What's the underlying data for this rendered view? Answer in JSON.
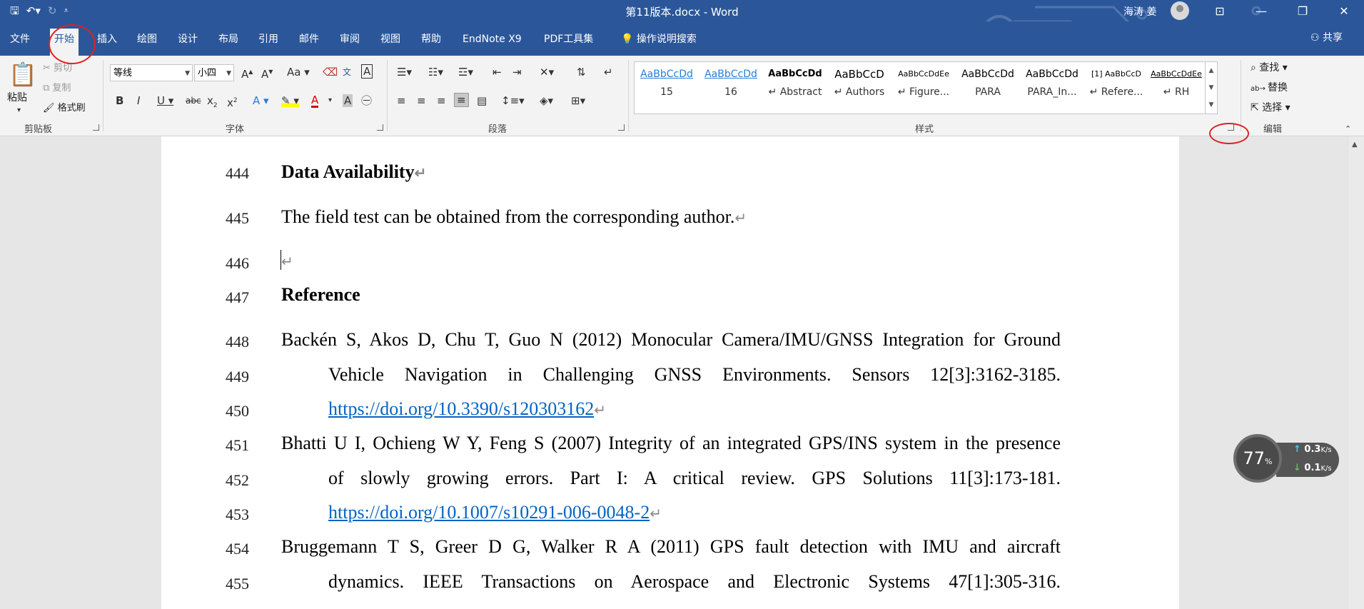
{
  "window": {
    "title": "第11版本.docx  -  Word",
    "user": "海涛 姜",
    "qat_icons": [
      "save-icon",
      "undo-icon",
      "redo-icon",
      "customize-qat-icon"
    ],
    "controls": [
      "ribbon-display-icon",
      "minimize-icon",
      "restore-icon",
      "close-icon"
    ]
  },
  "tabs": [
    "文件",
    "开始",
    "插入",
    "绘图",
    "设计",
    "布局",
    "引用",
    "邮件",
    "审阅",
    "视图",
    "帮助",
    "EndNote X9",
    "PDF工具集",
    "操作说明搜索"
  ],
  "share_label": "共享",
  "ribbon": {
    "clipboard": {
      "paste": "粘贴",
      "cut": "剪切",
      "copy": "复制",
      "format_painter": "格式刷",
      "label": "剪贴板"
    },
    "font": {
      "name": "等线",
      "size": "小四",
      "label": "字体",
      "change_case": "Aa"
    },
    "paragraph": {
      "label": "段落"
    },
    "styles": {
      "label": "样式",
      "items": [
        {
          "preview": "AaBbCcDd",
          "name": "15"
        },
        {
          "preview": "AaBbCcDd",
          "name": "16"
        },
        {
          "preview": "AaBbCcDd",
          "name": "↵ Abstract"
        },
        {
          "preview": "AaBbCcD",
          "name": "↵ Authors"
        },
        {
          "preview": "AaBbCcDdEe",
          "name": "↵ Figure..."
        },
        {
          "preview": "AaBbCcDd",
          "name": "PARA"
        },
        {
          "preview": "AaBbCcDd",
          "name": "PARA_In..."
        },
        {
          "preview": "[1] AaBbCcD",
          "name": "↵ Refere..."
        },
        {
          "preview": "AaBbCcDdEe",
          "name": "↵ RH"
        }
      ]
    },
    "editing": {
      "find": "查找",
      "replace": "替换",
      "select": "选择",
      "label": "编辑"
    }
  },
  "document": {
    "lines": [
      {
        "num": "444",
        "text": "Data Availability",
        "bold": true
      },
      {
        "num": "445",
        "text": "The field test can be obtained from the corresponding author."
      },
      {
        "num": "446",
        "text": ""
      },
      {
        "num": "447",
        "text": "Reference",
        "bold": true
      },
      {
        "num": "448",
        "text": "Backén S, Akos D, Chu T, Guo N (2012) Monocular Camera/IMU/GNSS Integration for Ground"
      },
      {
        "num": "449",
        "text": "Vehicle Navigation in Challenging GNSS Environments. Sensors 12[3]:3162-3185."
      },
      {
        "num": "450",
        "text": "https://doi.org/10.3390/s120303162"
      },
      {
        "num": "451",
        "text": "Bhatti U I, Ochieng W Y, Feng S (2007) Integrity of an integrated GPS/INS system in the presence"
      },
      {
        "num": "452",
        "text": "of slowly growing errors. Part I: A critical review. GPS Solutions 11[3]:173-181."
      },
      {
        "num": "453",
        "text": "https://doi.org/10.1007/s10291-006-0048-2"
      },
      {
        "num": "454",
        "text": "Bruggemann T S, Greer D G, Walker R A (2011) GPS fault detection with IMU and aircraft"
      },
      {
        "num": "455",
        "text": "dynamics. IEEE Transactions on Aerospace and Electronic Systems 47[1]:305-316."
      }
    ],
    "para_mark": "↵"
  },
  "widget": {
    "percent": "77",
    "percent_unit": "%",
    "up": "0.3",
    "down": "0.1",
    "unit": "K/s"
  },
  "colors": {
    "ribbon_blue": "#2b579a",
    "link": "#0563c1",
    "annotation": "#e02020"
  }
}
